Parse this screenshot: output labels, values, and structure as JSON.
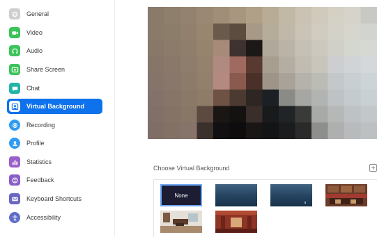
{
  "sidebar": {
    "items": [
      {
        "label": "General",
        "icon": "gear-icon",
        "color": "#c9c9c9"
      },
      {
        "label": "Video",
        "icon": "video-camera-icon",
        "color": "#3cc45a"
      },
      {
        "label": "Audio",
        "icon": "headphones-icon",
        "color": "#3cc45a"
      },
      {
        "label": "Share Screen",
        "icon": "share-screen-icon",
        "color": "#3cc45a"
      },
      {
        "label": "Chat",
        "icon": "chat-bubble-icon",
        "color": "#23b5a8"
      },
      {
        "label": "Virtual Background",
        "icon": "person-background-icon",
        "color": "#0e72ed",
        "active": true
      },
      {
        "label": "Recording",
        "icon": "record-icon",
        "color": "#2f9bf2"
      },
      {
        "label": "Profile",
        "icon": "person-icon",
        "color": "#2f9bf2"
      },
      {
        "label": "Statistics",
        "icon": "bar-chart-icon",
        "color": "#9a5fc8"
      },
      {
        "label": "Feedback",
        "icon": "smiley-icon",
        "color": "#8b5fc8"
      },
      {
        "label": "Keyboard Shortcuts",
        "icon": "keyboard-icon",
        "color": "#6b66c4"
      },
      {
        "label": "Accessibility",
        "icon": "accessibility-icon",
        "color": "#5f6ec8"
      }
    ]
  },
  "main": {
    "section_label": "Choose Virtual Background",
    "add_button_icon": "add-image-icon",
    "thumbnails": [
      {
        "label": "None",
        "selected": true
      },
      {
        "label": ""
      },
      {
        "label": ""
      },
      {
        "label": ""
      },
      {
        "label": ""
      },
      {
        "label": ""
      }
    ]
  },
  "colors": {
    "accent": "#0e72ed",
    "none_thumb_bg": "#1c1d33",
    "selected_border": "#6ba6f5"
  }
}
